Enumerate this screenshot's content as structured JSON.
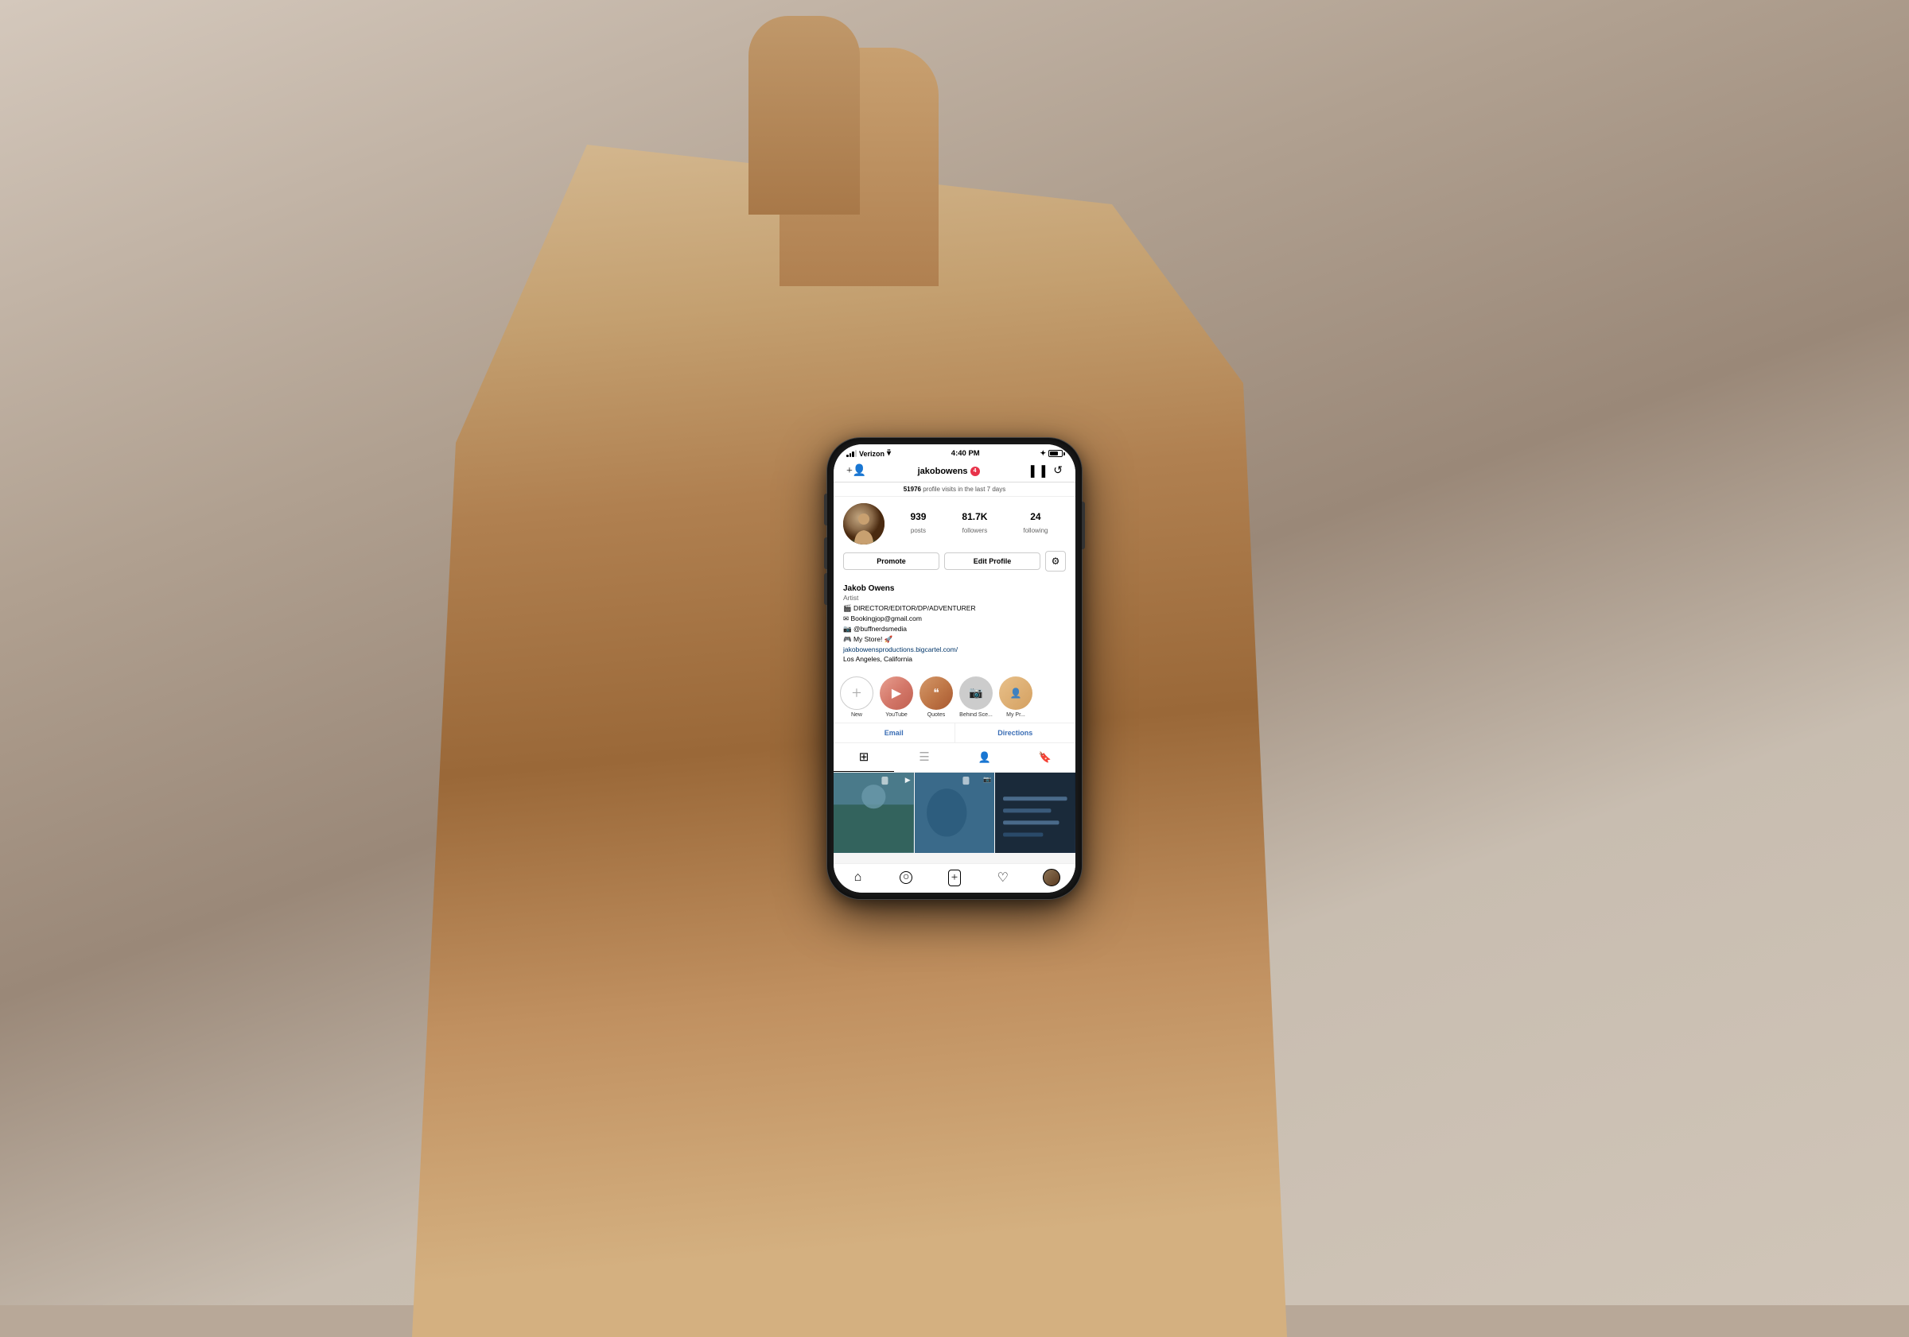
{
  "background": {
    "color": "#b0a090"
  },
  "phone": {
    "status_bar": {
      "carrier": "Verizon",
      "time": "4:40 PM",
      "battery_level": 70
    },
    "nav_bar": {
      "add_user_icon": "+👤",
      "username": "jakobowens",
      "notification_count": "4",
      "chart_icon": "📊",
      "clock_icon": "🕐"
    },
    "insights": {
      "text_prefix": "",
      "count": "51976",
      "text_suffix": " profile visits in the last 7 days"
    },
    "profile": {
      "avatar_alt": "Jakob Owens profile photo",
      "stats": [
        {
          "number": "939",
          "label": "posts"
        },
        {
          "number": "81.7K",
          "label": "followers"
        },
        {
          "number": "24",
          "label": "following"
        }
      ],
      "promote_label": "Promote",
      "edit_profile_label": "Edit Profile",
      "settings_icon": "⚙",
      "name": "Jakob Owens",
      "category": "Artist",
      "bio_lines": [
        "🎬 DIRECTOR/EDITOR/DP/ADVENTURER",
        "📧 Bookingjop@gmail.com",
        "📸 @buffnerdsmedia",
        "🎮 My Store! 🚀",
        "jakobowensproductions.bigcartel.com/",
        "Los Angeles, California"
      ]
    },
    "stories": [
      {
        "id": "new",
        "icon": "+",
        "label": "New",
        "type": "add"
      },
      {
        "id": "youtube",
        "icon": "▶",
        "label": "YouTube",
        "type": "youtube"
      },
      {
        "id": "quotes",
        "icon": "❝",
        "label": "Quotes",
        "type": "quotes"
      },
      {
        "id": "behind",
        "icon": "📷",
        "label": "Behind Sce...",
        "type": "behind"
      },
      {
        "id": "mypr",
        "icon": "👤",
        "label": "My Pr...",
        "type": "mypr"
      }
    ],
    "contact_buttons": [
      {
        "label": "Email"
      },
      {
        "label": "Directions"
      }
    ],
    "tabs": [
      {
        "id": "grid",
        "icon": "⊞",
        "active": true
      },
      {
        "id": "list",
        "icon": "≡",
        "active": false
      },
      {
        "id": "tagged",
        "icon": "👤",
        "active": false
      },
      {
        "id": "saved",
        "icon": "🔖",
        "active": false
      }
    ],
    "bottom_nav": [
      {
        "id": "home",
        "icon": "⌂"
      },
      {
        "id": "search",
        "icon": "○"
      },
      {
        "id": "add",
        "icon": "⊕"
      },
      {
        "id": "heart",
        "icon": "♡"
      },
      {
        "id": "profile",
        "icon": "avatar"
      }
    ]
  }
}
